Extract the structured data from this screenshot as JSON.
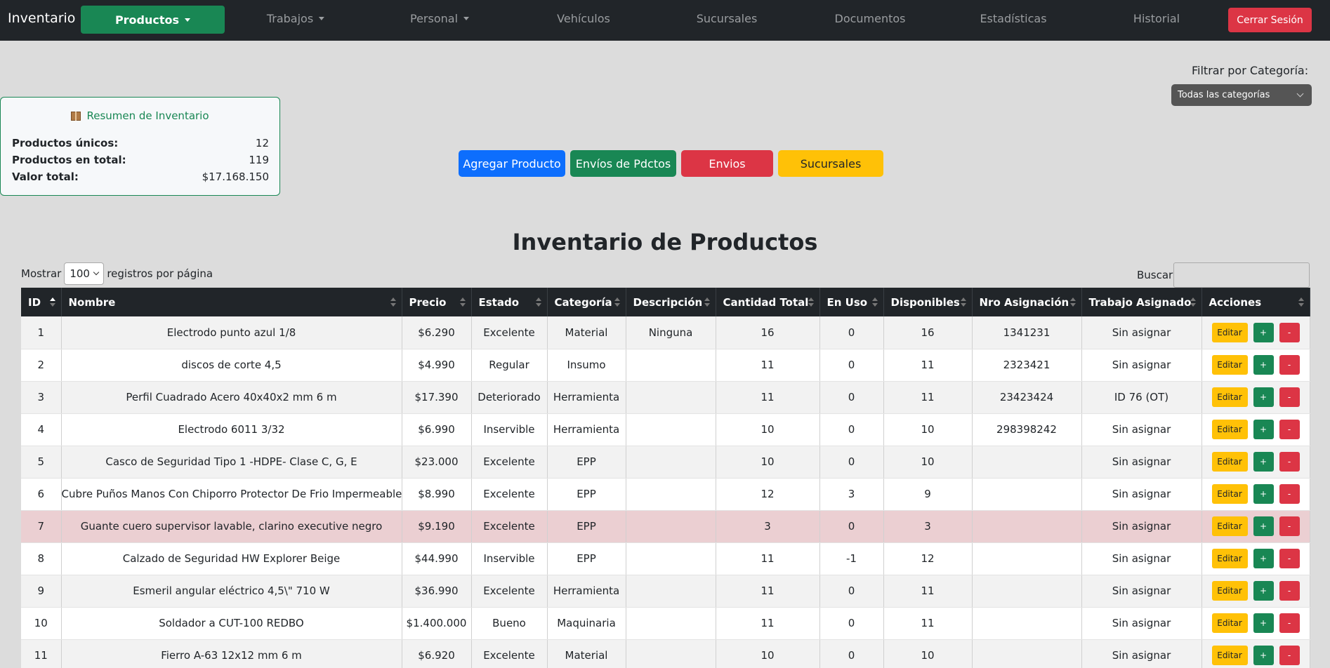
{
  "navbar": {
    "brand": "Inventario",
    "active": "Productos",
    "links": [
      "Trabajos",
      "Personal",
      "Vehículos",
      "Sucursales",
      "Documentos",
      "Estadísticas",
      "Historial"
    ],
    "logout": "Cerrar Sesión"
  },
  "filter": {
    "label": "Filtrar por Categoría:",
    "selected": "Todas las categorías"
  },
  "summary": {
    "title": "Resumen de Inventario",
    "icon": "package-icon",
    "unique_label": "Productos únicos:",
    "unique_value": "12",
    "total_label": "Productos en total:",
    "total_value": "119",
    "value_label": "Valor total:",
    "value_value": "$17.168.150"
  },
  "actions": {
    "add": "Agregar Producto",
    "shipments_products": "Envíos de Pdctos",
    "shipments": "Envios",
    "branches": "Sucursales"
  },
  "title": "Inventario de Productos",
  "table_controls": {
    "show_label": "Mostrar",
    "page_size": "100",
    "per_page_label": "registros por página",
    "search_label": "Buscar:"
  },
  "table": {
    "headers": [
      "ID",
      "Nombre",
      "Precio",
      "Estado",
      "Categoría",
      "Descripción",
      "Cantidad Total",
      "En Uso",
      "Disponibles",
      "Nro Asignación",
      "Trabajo Asignado",
      "Acciones"
    ],
    "edit_label": "Editar",
    "plus_label": "+",
    "minus_label": "-",
    "rows": [
      [
        "1",
        "Electrodo punto azul 1/8",
        "$6.290",
        "Excelente",
        "Material",
        "Ninguna",
        "16",
        "0",
        "16",
        "1341231",
        "Sin asignar"
      ],
      [
        "2",
        "discos de corte 4,5",
        "$4.990",
        "Regular",
        "Insumo",
        "",
        "11",
        "0",
        "11",
        "2323421",
        "Sin asignar"
      ],
      [
        "3",
        "Perfil Cuadrado Acero 40x40x2 mm 6 m",
        "$17.390",
        "Deteriorado",
        "Herramienta",
        "",
        "11",
        "0",
        "11",
        "23423424",
        "ID 76 (OT)"
      ],
      [
        "4",
        "Electrodo 6011 3/32",
        "$6.990",
        "Inservible",
        "Herramienta",
        "",
        "10",
        "0",
        "10",
        "298398242",
        "Sin asignar"
      ],
      [
        "5",
        "Casco de Seguridad Tipo 1 -HDPE- Clase C, G, E",
        "$23.000",
        "Excelente",
        "EPP",
        "",
        "10",
        "0",
        "10",
        "",
        "Sin asignar"
      ],
      [
        "6",
        "Cubre Puños Manos Con Chiporro Protector De Frio Impermeable",
        "$8.990",
        "Excelente",
        "EPP",
        "",
        "12",
        "3",
        "9",
        "",
        "Sin asignar"
      ],
      [
        "7",
        "Guante cuero supervisor lavable, clarino executive negro",
        "$9.190",
        "Excelente",
        "EPP",
        "",
        "3",
        "0",
        "3",
        "",
        "Sin asignar"
      ],
      [
        "8",
        "Calzado de Seguridad HW Explorer Beige",
        "$44.990",
        "Inservible",
        "EPP",
        "",
        "11",
        "-1",
        "12",
        "",
        "Sin asignar"
      ],
      [
        "9",
        "Esmeril angular eléctrico 4,5\\\" 710 W",
        "$36.990",
        "Excelente",
        "Herramienta",
        "",
        "11",
        "0",
        "11",
        "",
        "Sin asignar"
      ],
      [
        "10",
        "Soldador a CUT-100 REDBO",
        "$1.400.000",
        "Bueno",
        "Maquinaria",
        "",
        "11",
        "0",
        "11",
        "",
        "Sin asignar"
      ],
      [
        "11",
        "Fierro A-63 12x12 mm 6 m",
        "$6.920",
        "Excelente",
        "Material",
        "",
        "10",
        "0",
        "10",
        "",
        "Sin asignar"
      ]
    ],
    "highlight_row_id": "7",
    "highlight_color": "#ebcfd2"
  },
  "colors": {
    "primary": "#0d6efd",
    "success": "#198754",
    "danger": "#dc3545",
    "warning": "#ffc107",
    "dark": "#212529"
  }
}
